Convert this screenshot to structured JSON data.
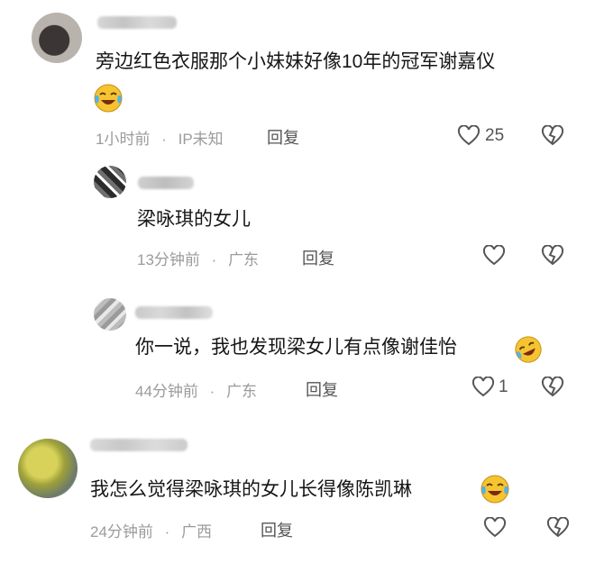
{
  "comments": [
    {
      "text": "旁边红色衣服那个小妹妹好像10年的冠军谢嘉仪",
      "emoji": "laughing-crying-emoji",
      "time": "1小时前",
      "separator": "·",
      "location": "IP未知",
      "reply": "回复",
      "likes": "25"
    },
    {
      "text": "梁咏琪的女儿",
      "time": "13分钟前",
      "separator": "·",
      "location": "广东",
      "reply": "回复",
      "likes": ""
    },
    {
      "text": "你一说，我也发现梁女儿有点像谢佳怡",
      "emoji": "rolling-laughing-emoji",
      "time": "44分钟前",
      "separator": "·",
      "location": "广东",
      "reply": "回复",
      "likes": "1"
    },
    {
      "text": "我怎么觉得梁咏琪的女儿长得像陈凯琳",
      "emoji": "laughing-crying-emoji",
      "time": "24分钟前",
      "separator": "·",
      "location": "广西",
      "reply": "回复",
      "likes": ""
    }
  ],
  "colors": {
    "text": "#161616",
    "meta": "#9b9b9b",
    "icon": "#555555",
    "emoji_face": "#f6c431"
  },
  "icons": [
    "heart-icon",
    "broken-heart-icon"
  ]
}
